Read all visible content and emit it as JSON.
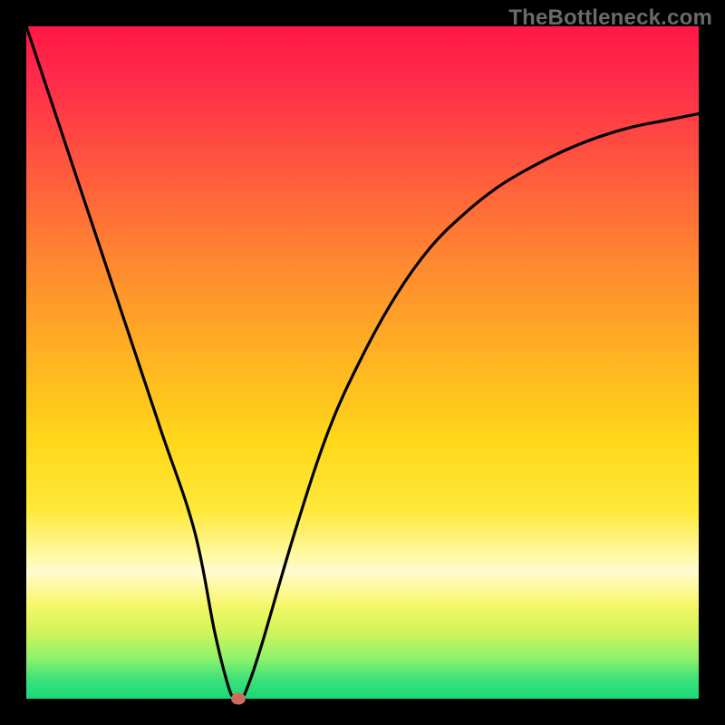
{
  "watermark": "TheBottleneck.com",
  "chart_data": {
    "type": "line",
    "title": "",
    "xlabel": "",
    "ylabel": "",
    "xlim": [
      0,
      100
    ],
    "ylim": [
      0,
      100
    ],
    "series": [
      {
        "name": "bottleneck-curve",
        "x": [
          0,
          5,
          10,
          15,
          20,
          25,
          28,
          30,
          31,
          32,
          33,
          35,
          40,
          45,
          50,
          55,
          60,
          65,
          70,
          75,
          80,
          85,
          90,
          95,
          100
        ],
        "values": [
          100,
          85,
          70,
          55,
          40,
          25,
          10,
          2,
          0,
          0,
          2,
          8,
          25,
          40,
          51,
          60,
          67,
          72,
          76,
          79,
          81.5,
          83.5,
          85,
          86,
          87
        ]
      }
    ],
    "marker": {
      "x": 31.5,
      "y": 0,
      "color": "#d06a5a"
    },
    "gradient_stops": [
      {
        "pos": 0,
        "color": "#ff1846"
      },
      {
        "pos": 50,
        "color": "#ffb522"
      },
      {
        "pos": 80,
        "color": "#fffad0"
      },
      {
        "pos": 100,
        "color": "#18d877"
      }
    ]
  }
}
